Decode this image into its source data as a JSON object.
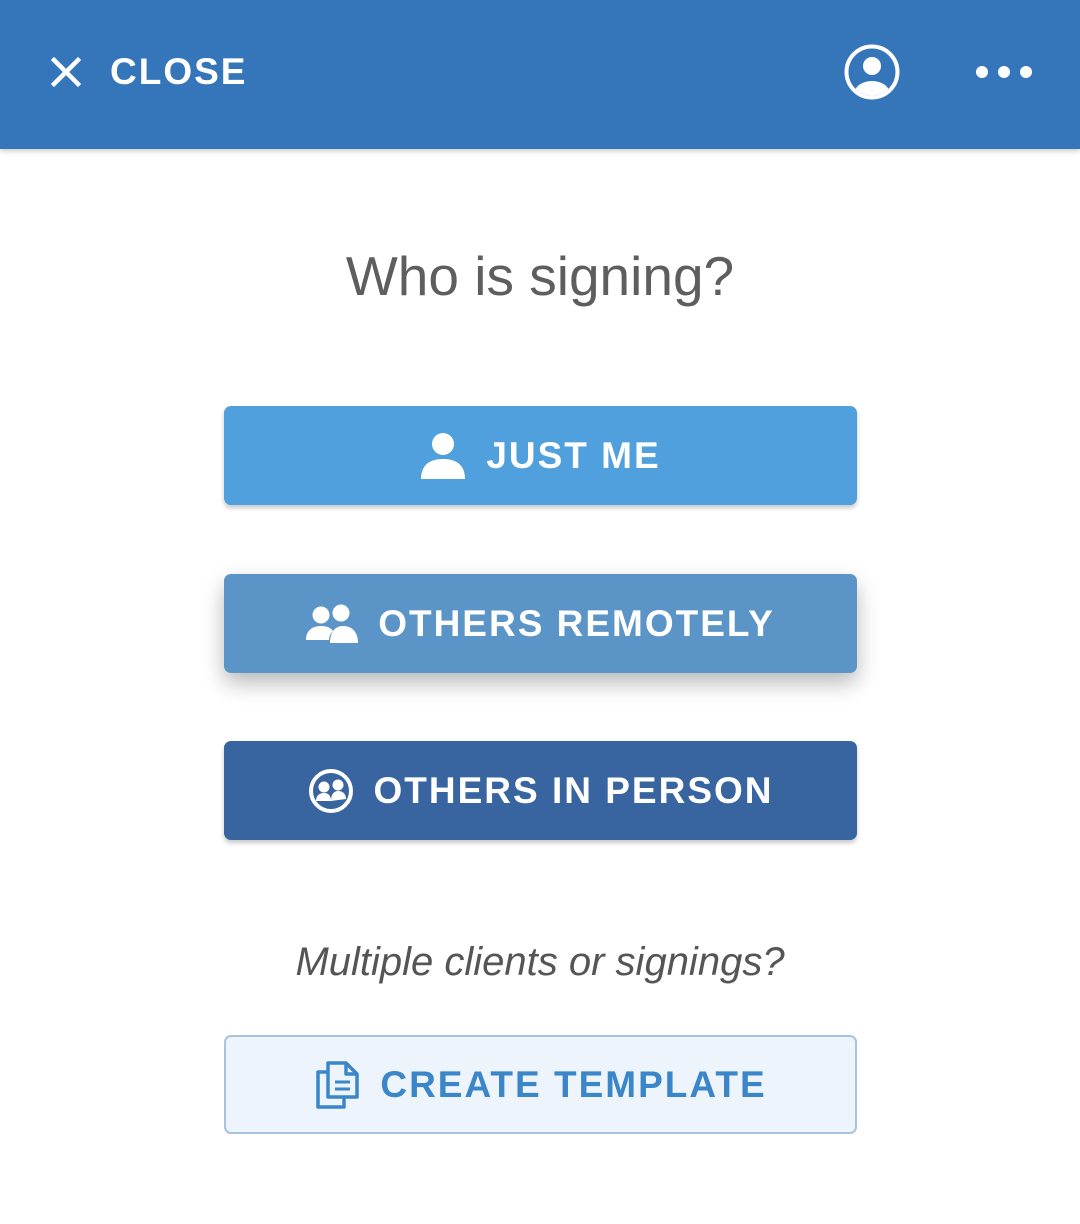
{
  "header": {
    "close_label": "CLOSE",
    "icons": {
      "close": "close-icon",
      "account": "account-icon",
      "more": "more-icon"
    }
  },
  "main": {
    "title": "Who is signing?",
    "options": [
      {
        "label": "JUST ME",
        "icon": "person-icon"
      },
      {
        "label": "OTHERS REMOTELY",
        "icon": "people-icon"
      },
      {
        "label": "OTHERS IN PERSON",
        "icon": "in-person-icon"
      }
    ],
    "subtitle": "Multiple clients or signings?",
    "template_label": "CREATE TEMPLATE",
    "template_icon": "documents-icon"
  },
  "colors": {
    "header": "#3576bb",
    "just_me": "#4fa0dc",
    "others_remotely": "#5b94c6",
    "others_in_person": "#3864a0",
    "template_bg": "#eef4fc",
    "template_text": "#3b86c8"
  }
}
